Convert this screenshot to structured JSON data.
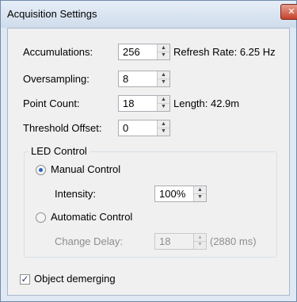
{
  "window": {
    "title": "Acquisition Settings",
    "close_glyph": "✕"
  },
  "fields": {
    "accumulations": {
      "label": "Accumulations:",
      "value": "256",
      "info": "Refresh Rate: 6.25 Hz"
    },
    "oversampling": {
      "label": "Oversampling:",
      "value": "8"
    },
    "point_count": {
      "label": "Point Count:",
      "value": "18",
      "info": "Length: 42.9m"
    },
    "threshold_offset": {
      "label": "Threshold Offset:",
      "value": "0"
    }
  },
  "led_control": {
    "title": "LED Control",
    "manual": {
      "label": "Manual Control",
      "selected": true
    },
    "intensity": {
      "label": "Intensity:",
      "value": "100%"
    },
    "automatic": {
      "label": "Automatic Control",
      "selected": false
    },
    "change_delay": {
      "label": "Change Delay:",
      "value": "18",
      "info": "(2880 ms)"
    }
  },
  "object_demerging": {
    "label": "Object demerging",
    "checked": true
  },
  "icons": {
    "up": "▲",
    "down": "▼",
    "check": "✓"
  }
}
